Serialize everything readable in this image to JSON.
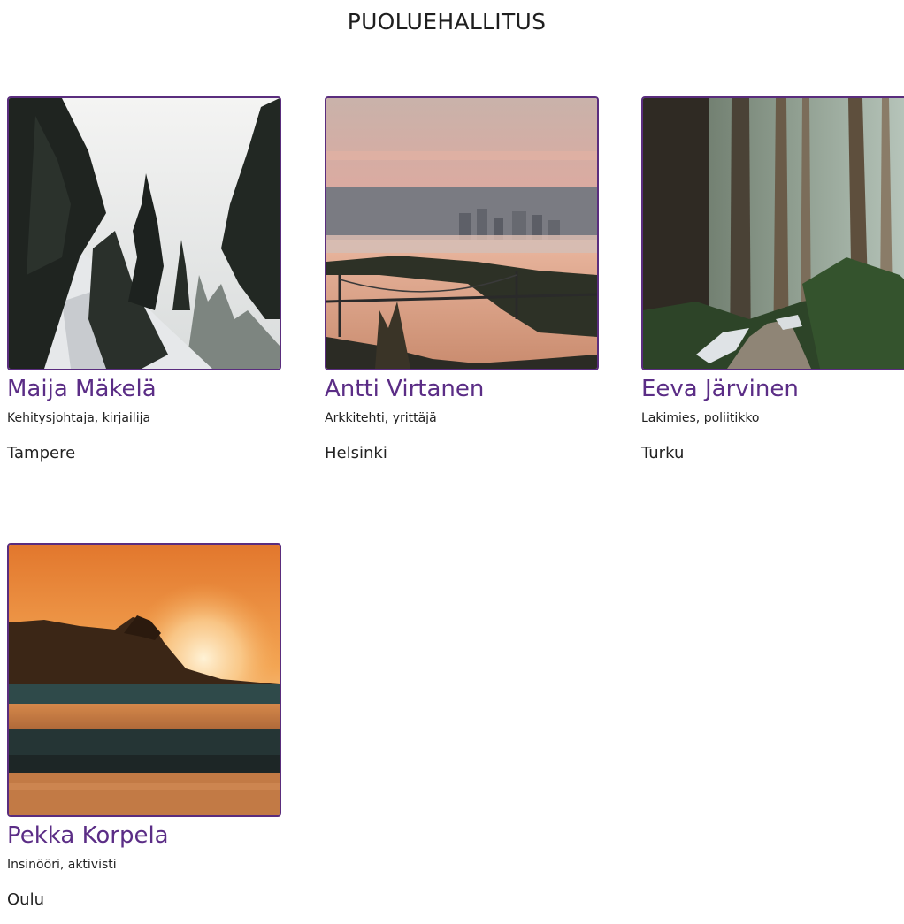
{
  "page": {
    "title": "PUOLUEHALLITUS"
  },
  "colors": {
    "accent": "#5b2d86",
    "border": "#5a2d7e",
    "text": "#222222"
  },
  "members": [
    {
      "name": "Maija Mäkelä",
      "role": "Kehitysjohtaja, kirjailija",
      "city": "Tampere",
      "photo": "snowy-forest-slope"
    },
    {
      "name": "Antti Virtanen",
      "role": "Arkkitehti, yrittäjä",
      "city": "Helsinki",
      "photo": "city-bridge-sunset"
    },
    {
      "name": "Eeva Järvinen",
      "role": "Lakimies, poliitikko",
      "city": "Turku",
      "photo": "misty-forest-path"
    },
    {
      "name": "Pekka Korpela",
      "role": "Insinööri, aktivisti",
      "city": "Oulu",
      "photo": "beach-sunset"
    }
  ]
}
